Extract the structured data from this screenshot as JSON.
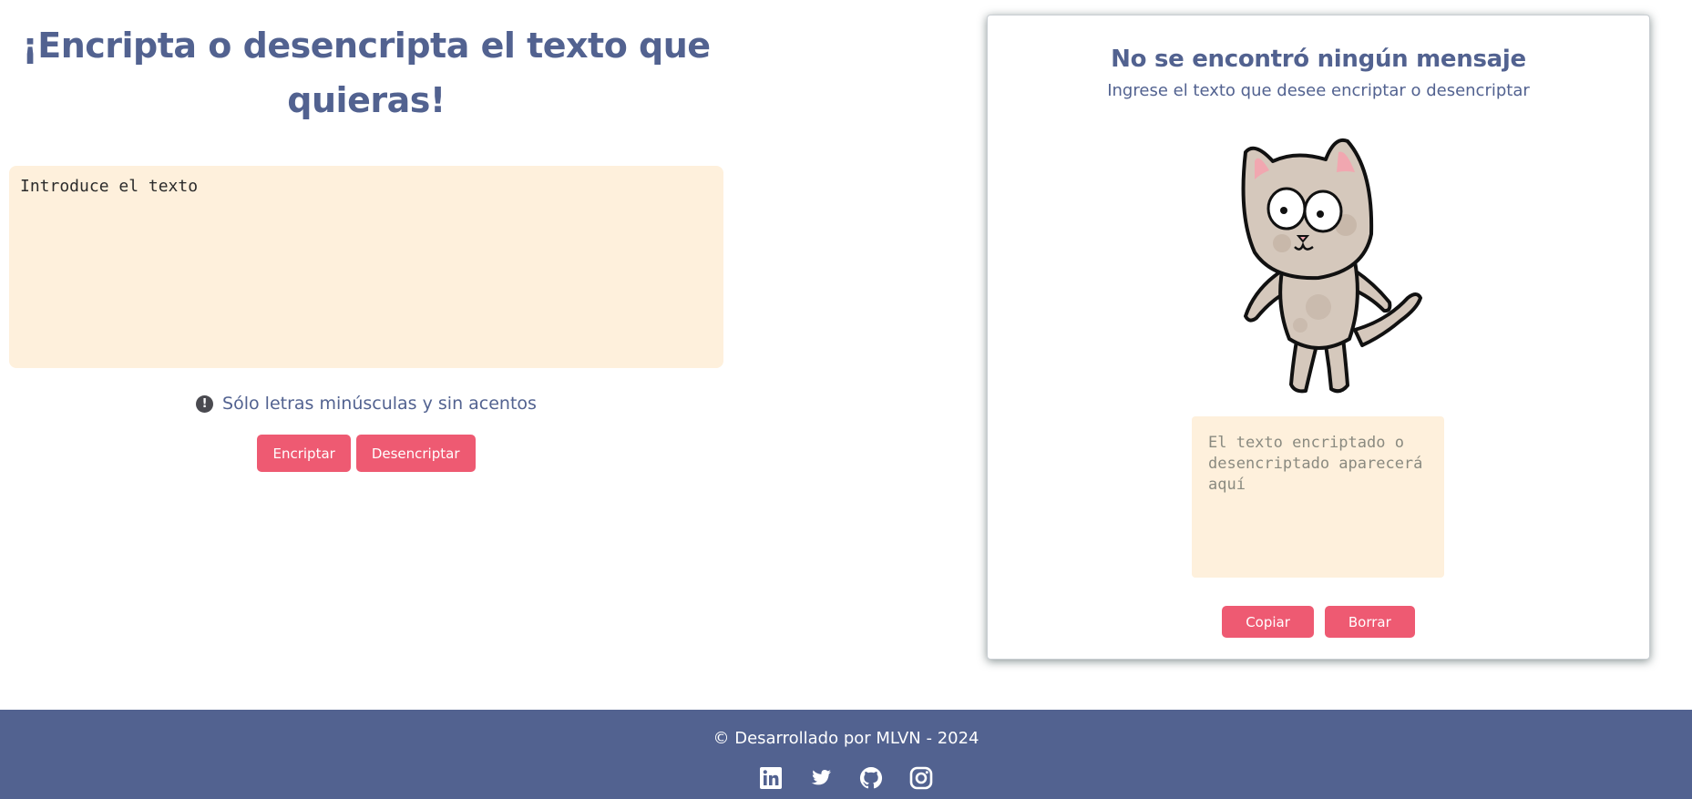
{
  "main": {
    "title": "¡Encripta o desencripta el texto que quieras!",
    "input_placeholder": "Introduce el texto",
    "hint": "Sólo letras minúsculas y sin acentos",
    "hint_icon": "exclamation-circle-icon",
    "encrypt_label": "Encriptar",
    "decrypt_label": "Desencriptar"
  },
  "result": {
    "title": "No se encontró ningún mensaje",
    "subtitle": "Ingrese el texto que desee encriptar o desencriptar",
    "image": "cartoon-cat",
    "output_placeholder": "El texto encriptado o desencriptado aparecerá aquí",
    "copy_label": "Copiar",
    "clear_label": "Borrar"
  },
  "footer": {
    "text": "© Desarrollado por MLVN - 2024",
    "social": [
      "linkedin-icon",
      "twitter-icon",
      "github-icon",
      "instagram-icon"
    ]
  },
  "colors": {
    "primary": "#526290",
    "button": "#ee5a72",
    "textarea_bg": "#fef0dc"
  }
}
